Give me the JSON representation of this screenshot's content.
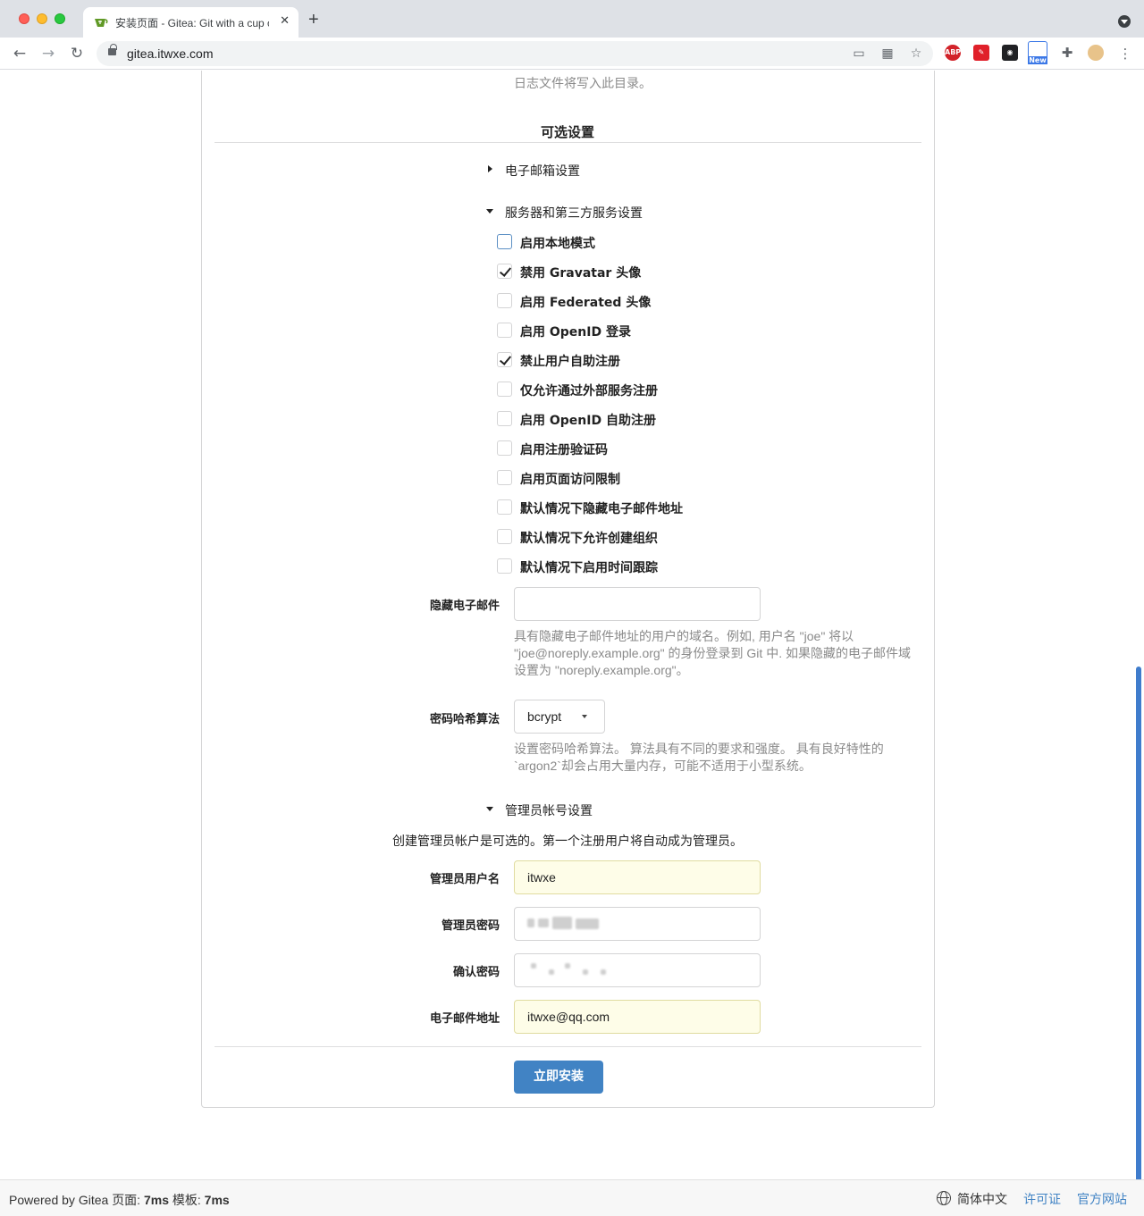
{
  "browser": {
    "tab_title": "安装页面 - Gitea: Git with a cup of tea",
    "url": "gitea.itwxe.com",
    "new_badge": "New",
    "abp_label": "ABP"
  },
  "top": {
    "log_help": "日志文件将写入此目录。"
  },
  "optional": {
    "title": "可选设置",
    "email_section": "电子邮箱设置",
    "server_section": "服务器和第三方服务设置",
    "checkboxes": [
      {
        "label": "启用本地模式",
        "checked": false
      },
      {
        "label": "禁用 Gravatar 头像",
        "checked": true
      },
      {
        "label": "启用 Federated 头像",
        "checked": false
      },
      {
        "label": "启用 OpenID 登录",
        "checked": false
      },
      {
        "label": "禁止用户自助注册",
        "checked": true
      },
      {
        "label": "仅允许通过外部服务注册",
        "checked": false
      },
      {
        "label": "启用 OpenID 自助注册",
        "checked": false
      },
      {
        "label": "启用注册验证码",
        "checked": false
      },
      {
        "label": "启用页面访问限制",
        "checked": false
      },
      {
        "label": "默认情况下隐藏电子邮件地址",
        "checked": false
      },
      {
        "label": "默认情况下允许创建组织",
        "checked": false
      },
      {
        "label": "默认情况下启用时间跟踪",
        "checked": false
      }
    ],
    "hidden_email": {
      "label": "隐藏电子邮件",
      "value": "",
      "help_line1": "具有隐藏电子邮件地址的用户的域名。例如, 用户名 \"joe\" 将以",
      "help_line2": "\"joe@noreply.example.org\" 的身份登录到 Git 中. 如果隐藏的电子邮件域",
      "help_line3": "设置为 \"noreply.example.org\"。"
    },
    "password_hash": {
      "label": "密码哈希算法",
      "value": "bcrypt",
      "help_line1": "设置密码哈希算法。 算法具有不同的要求和强度。 具有良好特性的",
      "help_line2": "`argon2`却会占用大量内存，可能不适用于小型系统。"
    },
    "admin_section": "管理员帐号设置",
    "admin_note": "创建管理员帐户是可选的。第一个注册用户将自动成为管理员。",
    "admin_username": {
      "label": "管理员用户名",
      "value": "itwxe"
    },
    "admin_password": {
      "label": "管理员密码"
    },
    "confirm_password": {
      "label": "确认密码"
    },
    "admin_email": {
      "label": "电子邮件地址",
      "value": "itwxe@qq.com"
    },
    "install_button": "立即安装"
  },
  "footer": {
    "powered": "Powered by Gitea",
    "page_label": "页面:",
    "page_time": "7ms",
    "template_label": "模板:",
    "template_time": "7ms",
    "language": "简体中文",
    "license": "许可证",
    "website": "官方网站"
  }
}
